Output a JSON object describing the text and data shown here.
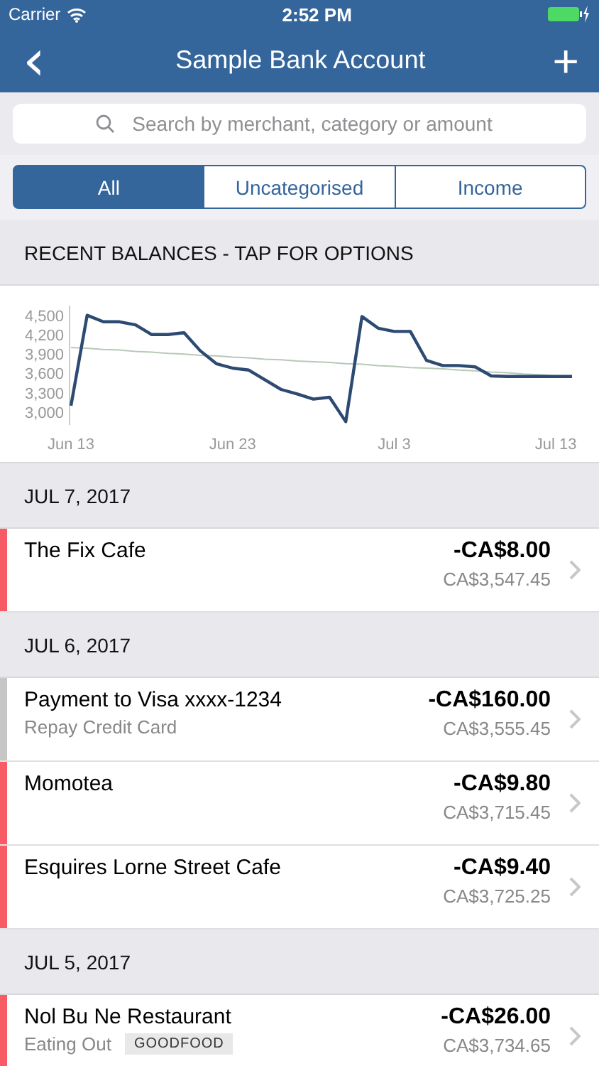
{
  "status_bar": {
    "carrier": "Carrier",
    "time": "2:52 PM"
  },
  "nav": {
    "title": "Sample Bank Account",
    "back": "‹",
    "add": "+"
  },
  "search": {
    "placeholder": "Search by merchant, category or amount"
  },
  "segments": [
    {
      "label": "All",
      "selected": true
    },
    {
      "label": "Uncategorised",
      "selected": false
    },
    {
      "label": "Income",
      "selected": false
    }
  ],
  "balances": {
    "title": "RECENT BALANCES - TAP FOR OPTIONS",
    "chart_data": {
      "type": "line",
      "categories": [
        "Jun 13",
        null,
        null,
        null,
        null,
        null,
        null,
        null,
        null,
        null,
        "Jun 23",
        null,
        null,
        null,
        null,
        null,
        null,
        null,
        null,
        null,
        "Jul 3",
        null,
        null,
        null,
        null,
        null,
        null,
        null,
        null,
        null,
        "Jul 13",
        null
      ],
      "ylim": [
        2800,
        4650
      ],
      "yticks": [
        {
          "value": 3000,
          "label": "3,000"
        },
        {
          "value": 3300,
          "label": "3,300"
        },
        {
          "value": 3600,
          "label": "3,600"
        },
        {
          "value": 3900,
          "label": "3,900"
        },
        {
          "value": 4200,
          "label": "4,200"
        },
        {
          "value": 4500,
          "label": "4,500"
        }
      ],
      "series": [
        {
          "color": "#2c4a72",
          "values": [
            3100,
            4500,
            4400,
            4400,
            4350,
            4200,
            4200,
            4230,
            3950,
            3750,
            3680,
            3650,
            3500,
            3350,
            3280,
            3200,
            3230,
            2850,
            4480,
            4300,
            4250,
            4250,
            3800,
            3720,
            3720,
            3700,
            3560,
            3550,
            3550,
            3550,
            3550,
            3550
          ]
        },
        {
          "color": "#b8c8b8",
          "values": [
            4000,
            3990,
            3970,
            3960,
            3940,
            3930,
            3910,
            3900,
            3880,
            3870,
            3850,
            3840,
            3820,
            3810,
            3790,
            3780,
            3770,
            3750,
            3740,
            3720,
            3710,
            3690,
            3680,
            3670,
            3650,
            3640,
            3620,
            3610,
            3590,
            3580,
            3560,
            3550
          ]
        }
      ]
    }
  },
  "sections": [
    {
      "date": "JUL 7, 2017",
      "transactions": [
        {
          "name": "The Fix Cafe",
          "amount": "-CA$8.00",
          "balance": "CA$3,547.45",
          "color": "#f75b63"
        }
      ]
    },
    {
      "date": "JUL 6, 2017",
      "transactions": [
        {
          "name": "Payment to Visa xxxx-1234",
          "category": "Repay Credit Card",
          "amount": "-CA$160.00",
          "balance": "CA$3,555.45",
          "color": "#c6c6c6"
        },
        {
          "name": "Momotea",
          "amount": "-CA$9.80",
          "balance": "CA$3,715.45",
          "color": "#f75b63"
        },
        {
          "name": "Esquires Lorne Street Cafe",
          "amount": "-CA$9.40",
          "balance": "CA$3,725.25",
          "color": "#f75b63"
        }
      ]
    },
    {
      "date": "JUL 5, 2017",
      "transactions": [
        {
          "name": "Nol Bu Ne Restaurant",
          "category": "Eating Out",
          "tag": "GOODFOOD",
          "amount": "-CA$26.00",
          "balance": "CA$3,734.65",
          "color": "#f75b63"
        }
      ]
    }
  ]
}
